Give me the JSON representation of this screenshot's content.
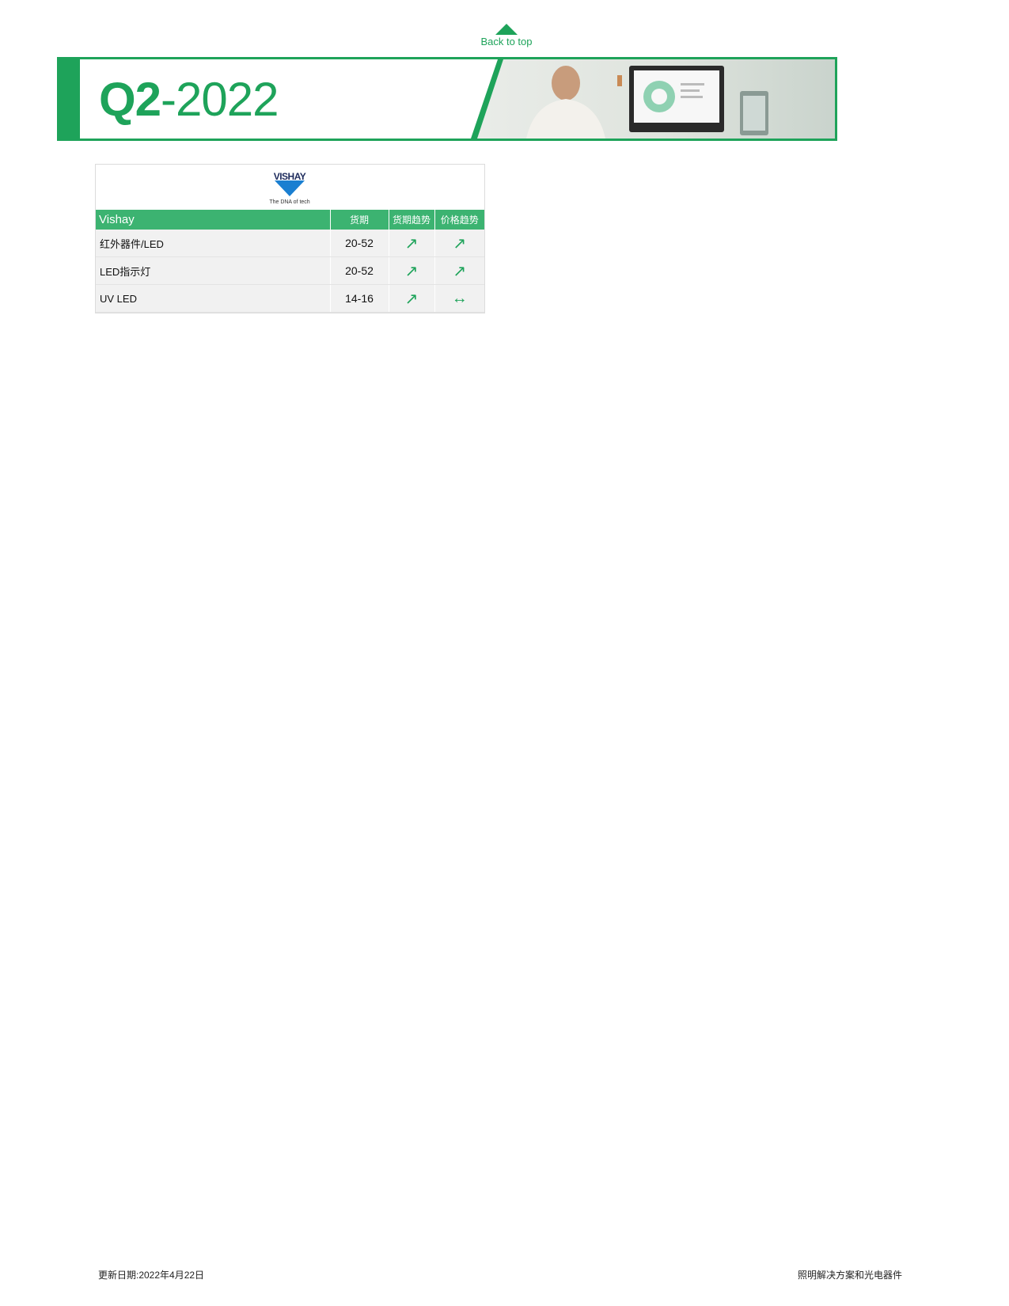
{
  "nav": {
    "back_to_top": "Back to top"
  },
  "banner": {
    "title_q": "Q2",
    "title_rest": "-2022"
  },
  "supplier": {
    "logo_text": "VISHAY",
    "logo_tagline": "The DNA of tech",
    "brand_color": "#1d2b5c"
  },
  "table": {
    "headers": [
      "Vishay",
      "货期",
      "货期趋势",
      "价格趋势"
    ],
    "rows": [
      {
        "product": "红外器件/LED",
        "lead_time": "20-52",
        "lead_trend": "↗",
        "price_trend": "↗"
      },
      {
        "product": "LED指示灯",
        "lead_time": "20-52",
        "lead_trend": "↗",
        "price_trend": "↗"
      },
      {
        "product": "UV LED",
        "lead_time": "14-16",
        "lead_trend": "↗",
        "price_trend": "↔"
      }
    ]
  },
  "footer": {
    "updated": "更新日期:2022年4月22日",
    "category": "照明解决方案和光电器件"
  },
  "colors": {
    "accent": "#1ea35a",
    "header_bg": "#3cb371",
    "row_bg": "#f1f1f1"
  }
}
